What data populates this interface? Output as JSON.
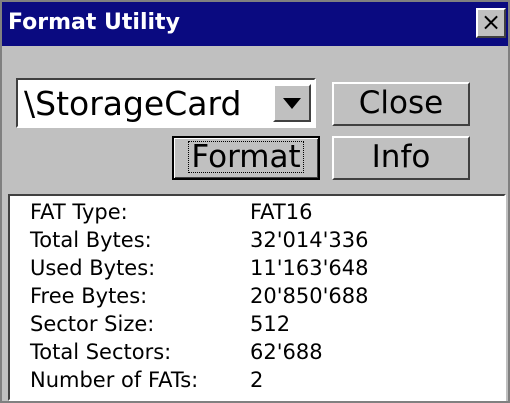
{
  "window": {
    "title": "Format Utility",
    "close_glyph": "×"
  },
  "controls": {
    "volume_select": "\\StorageCard",
    "close_label": "Close",
    "format_label": "Format",
    "info_label": "Info"
  },
  "details": [
    {
      "key": "FAT Type:",
      "value": "FAT16"
    },
    {
      "key": "Total Bytes:",
      "value": "32'014'336"
    },
    {
      "key": "Used Bytes:",
      "value": "11'163'648"
    },
    {
      "key": "Free Bytes:",
      "value": "20'850'688"
    },
    {
      "key": "Sector Size:",
      "value": "512"
    },
    {
      "key": "Total Sectors:",
      "value": "62'688"
    },
    {
      "key": "Number of FATs:",
      "value": "2"
    }
  ],
  "colors": {
    "titlebar": "#0a0a80",
    "face": "#c0c0c0"
  }
}
